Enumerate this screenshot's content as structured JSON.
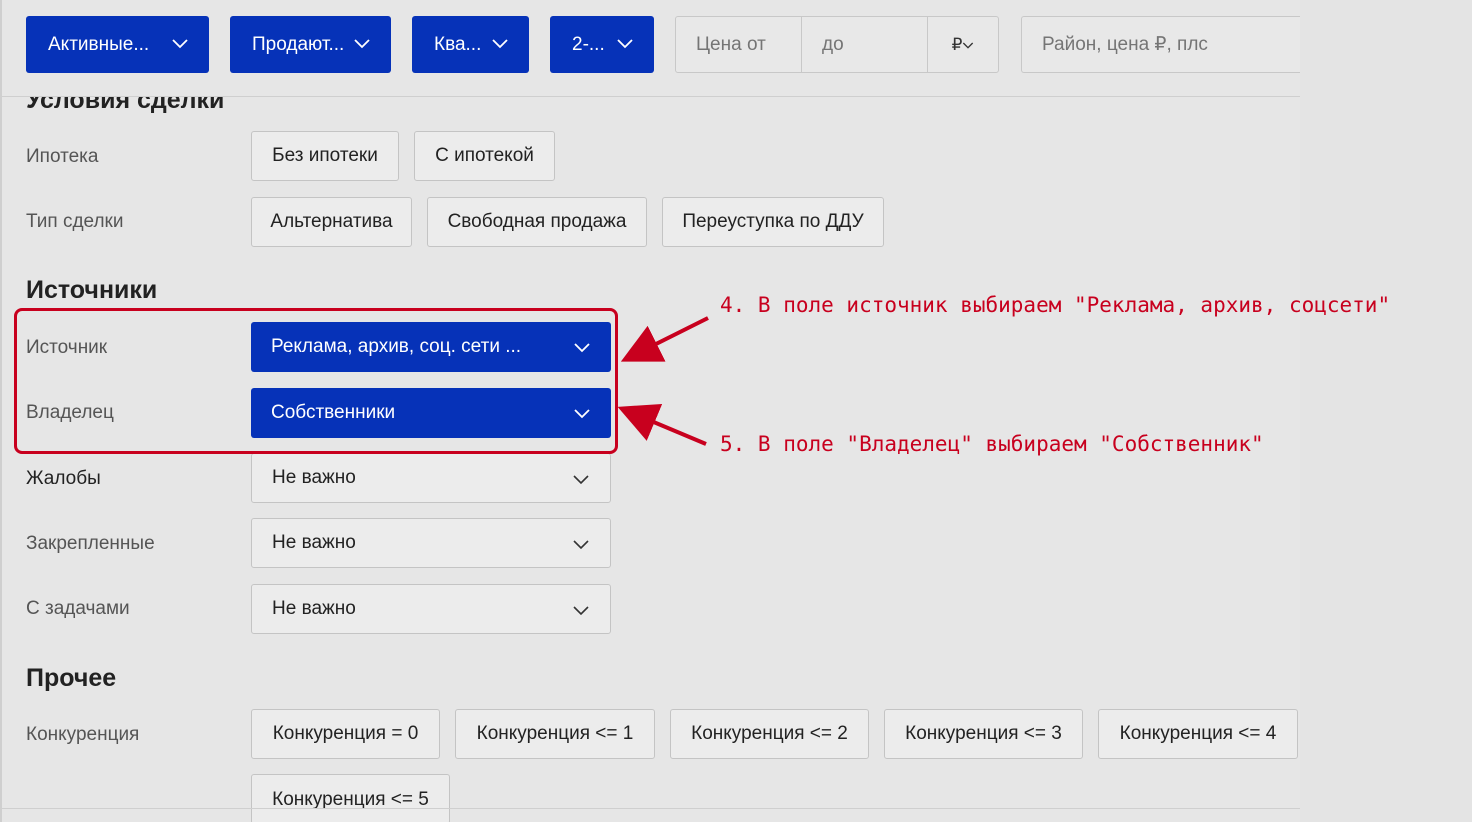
{
  "filters": {
    "status": "Активные...",
    "deal": "Продают...",
    "type": "Ква...",
    "rooms": "2-...",
    "price_from_placeholder": "Цена от",
    "price_to_placeholder": "до",
    "currency": "₽",
    "search_placeholder": "Район, цена ₽, плс"
  },
  "deal_conditions": {
    "title": "Условия сделки",
    "mortgage": {
      "label": "Ипотека",
      "options": [
        "Без ипотеки",
        "С ипотекой"
      ]
    },
    "deal_type": {
      "label": "Тип сделки",
      "options": [
        "Альтернатива",
        "Свободная продажа",
        "Переуступка по ДДУ"
      ]
    }
  },
  "sources": {
    "title": "Источники",
    "source": {
      "label": "Источник",
      "value": "Реклама, архив, соц. сети ..."
    },
    "owner": {
      "label": "Владелец",
      "value": "Собственники"
    },
    "complaints": {
      "label": "Жалобы",
      "value": "Не важно"
    },
    "pinned": {
      "label": "Закрепленные",
      "value": "Не важно"
    },
    "tasks": {
      "label": "С задачами",
      "value": "Не важно"
    }
  },
  "other": {
    "title": "Прочее",
    "competition": {
      "label": "Конкуренция",
      "options": [
        "Конкуренция = 0",
        "Конкуренция <= 1",
        "Конкуренция <= 2",
        "Конкуренция <= 3",
        "Конкуренция <= 4",
        "Конкуренция <= 5"
      ]
    }
  },
  "annotations": {
    "note4": "4. В поле источник выбираем \"Реклама, архив, соцсети\"",
    "note5": "5. В поле \"Владелец\" выбираем \"Собственник\"",
    "color": "#c8001e"
  },
  "colors": {
    "accent": "#0632b8",
    "background": "#e6e6e6"
  }
}
